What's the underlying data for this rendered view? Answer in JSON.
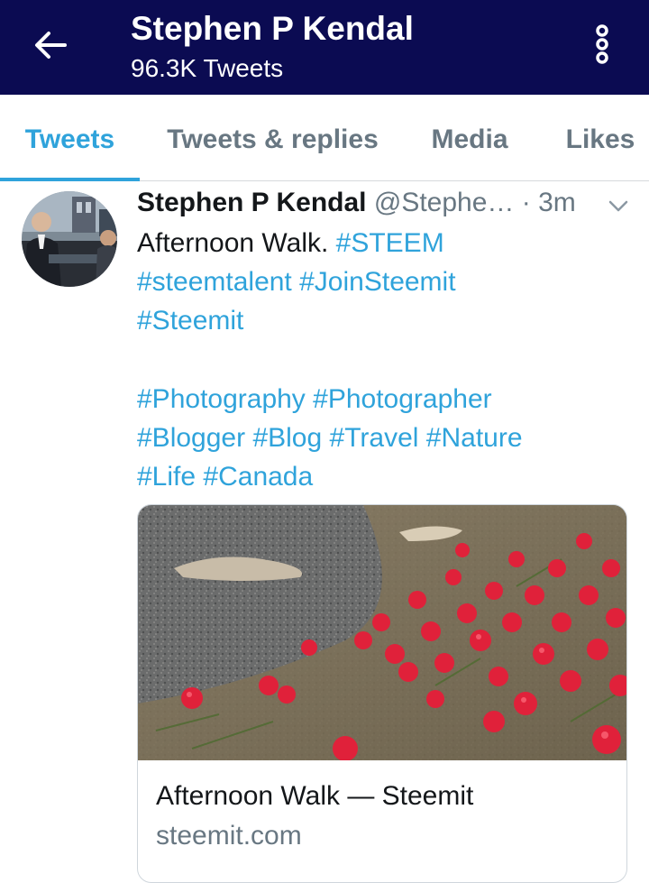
{
  "header": {
    "title": "Stephen P Kendal",
    "subtitle": "96.3K Tweets",
    "back_icon": "arrow-left-icon",
    "more_icon": "more-vertical-icon",
    "background_color": "#0b0b52"
  },
  "tabs": [
    {
      "label": "Tweets",
      "active": true
    },
    {
      "label": "Tweets & replies",
      "active": false
    },
    {
      "label": "Media",
      "active": false
    },
    {
      "label": "Likes",
      "active": false
    }
  ],
  "accent_color": "#2fa3db",
  "tweet": {
    "author_name": "Stephen P Kendal",
    "author_handle": "@Stephe…",
    "separator": "·",
    "time": "3m",
    "caret_icon": "chevron-down-icon",
    "text": {
      "line1_plain": "Afternoon Walk. ",
      "line1_tag": "#STEEM",
      "line2_tag1": "#steemtalent",
      "line2_tag2": "#JoinSteemit",
      "line3_tag": "#Steemit",
      "line5_tag1": "#Photography",
      "line5_tag2": "#Photographer",
      "line6_tag1": "#Blogger",
      "line6_tag2": "#Blog",
      "line6_tag3": "#Travel",
      "line6_tag4": "#Nature",
      "line7_tag1": "#Life",
      "line7_tag2": "#Canada"
    },
    "card": {
      "title": "Afternoon Walk — Steemit",
      "domain": "steemit.com"
    }
  }
}
